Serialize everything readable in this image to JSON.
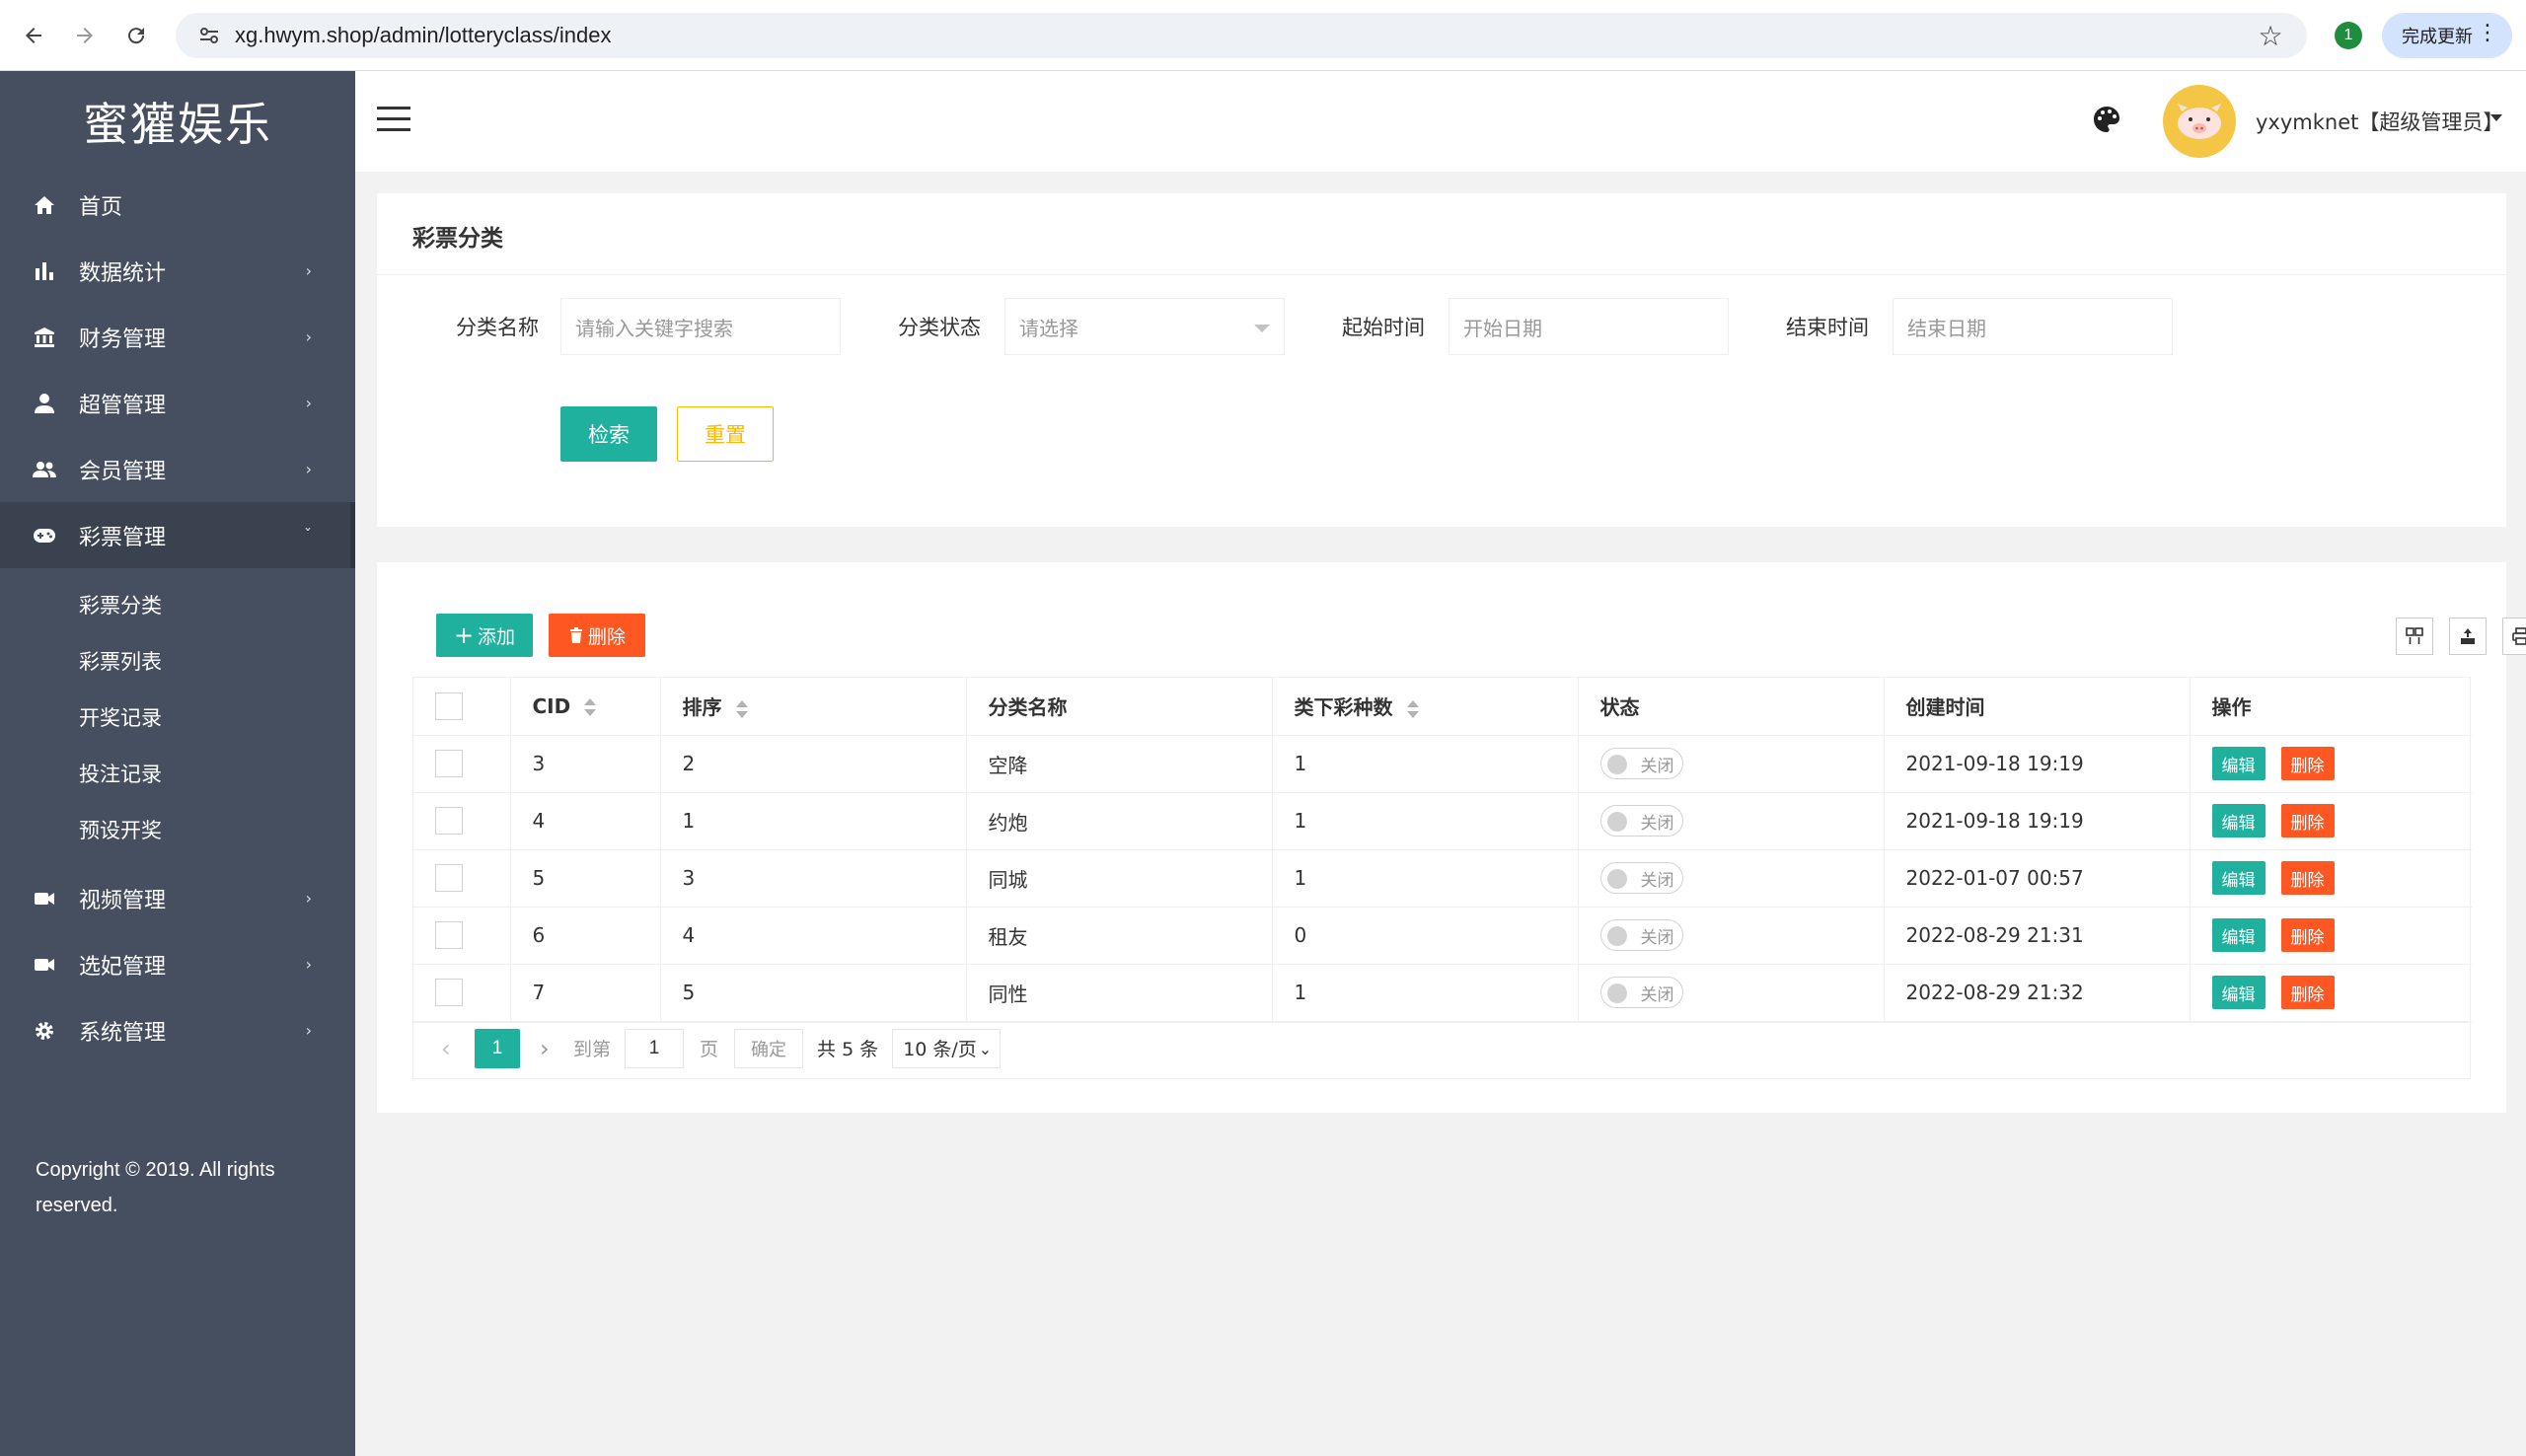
{
  "browser": {
    "url": "xg.hwym.shop/admin/lotteryclass/index",
    "extension_badge": "1",
    "update_label": "完成更新"
  },
  "sidebar": {
    "logo": "蜜獾娱乐",
    "items": [
      {
        "label": "首页",
        "icon": "home-icon",
        "has_children": false
      },
      {
        "label": "数据统计",
        "icon": "bar-chart-icon",
        "has_children": true
      },
      {
        "label": "财务管理",
        "icon": "bank-icon",
        "has_children": true
      },
      {
        "label": "超管管理",
        "icon": "user-icon",
        "has_children": true
      },
      {
        "label": "会员管理",
        "icon": "users-icon",
        "has_children": true
      },
      {
        "label": "彩票管理",
        "icon": "gamepad-icon",
        "has_children": true,
        "expanded": true
      },
      {
        "label": "视频管理",
        "icon": "video-icon",
        "has_children": true
      },
      {
        "label": "选妃管理",
        "icon": "video-icon",
        "has_children": true
      },
      {
        "label": "系统管理",
        "icon": "gear-icon",
        "has_children": true
      }
    ],
    "submenu": [
      "彩票分类",
      "彩票列表",
      "开奖记录",
      "投注记录",
      "预设开奖"
    ],
    "copyright": "Copyright © 2019. All rights reserved."
  },
  "header": {
    "user_name": "yxymknet【超级管理员】"
  },
  "search": {
    "title": "彩票分类",
    "name_label": "分类名称",
    "name_placeholder": "请输入关键字搜索",
    "status_label": "分类状态",
    "status_placeholder": "请选择",
    "start_label": "起始时间",
    "start_placeholder": "开始日期",
    "end_label": "结束时间",
    "end_placeholder": "结束日期",
    "search_button": "检索",
    "reset_button": "重置"
  },
  "table": {
    "add_button": "添加",
    "delete_button": "删除",
    "columns": [
      "CID",
      "排序",
      "分类名称",
      "类下彩种数",
      "状态",
      "创建时间",
      "操作"
    ],
    "rows": [
      {
        "cid": "3",
        "sort": "2",
        "name": "空降",
        "count": "1",
        "status": "关闭",
        "created": "2021-09-18 19:19"
      },
      {
        "cid": "4",
        "sort": "1",
        "name": "约炮",
        "count": "1",
        "status": "关闭",
        "created": "2021-09-18 19:19"
      },
      {
        "cid": "5",
        "sort": "3",
        "name": "同城",
        "count": "1",
        "status": "关闭",
        "created": "2022-01-07 00:57"
      },
      {
        "cid": "6",
        "sort": "4",
        "name": "租友",
        "count": "0",
        "status": "关闭",
        "created": "2022-08-29 21:31"
      },
      {
        "cid": "7",
        "sort": "5",
        "name": "同性",
        "count": "1",
        "status": "关闭",
        "created": "2022-08-29 21:32"
      }
    ],
    "edit_label": "编辑",
    "remove_label": "删除"
  },
  "pager": {
    "current": "1",
    "goto_label": "到第",
    "goto_value": "1",
    "page_label": "页",
    "confirm_label": "确定",
    "total_label": "共 5 条",
    "page_size": "10 条/页"
  },
  "colors": {
    "sidebar_bg": "#464f5f",
    "primary": "#1fb19e",
    "danger": "#ff5722",
    "warning": "#ffb800"
  }
}
